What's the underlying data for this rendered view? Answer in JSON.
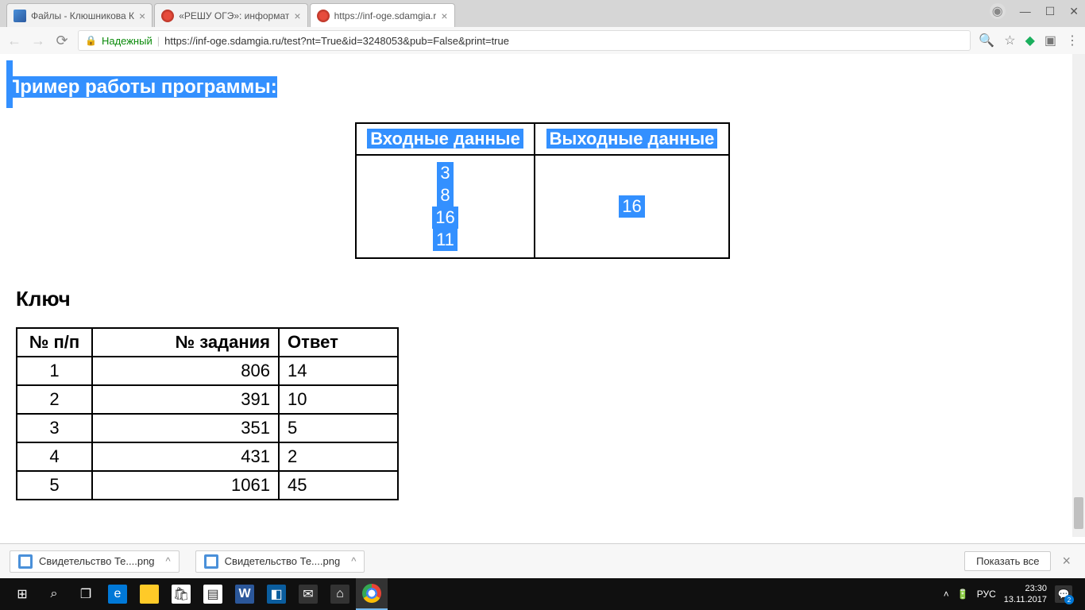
{
  "browser": {
    "tabs": [
      {
        "title": "Файлы - Клюшникова К",
        "active": false
      },
      {
        "title": "«РЕШУ ОГЭ»: информат",
        "active": false
      },
      {
        "title": "https://inf-oge.sdamgia.r",
        "active": true
      }
    ],
    "secure_label": "Надежный",
    "url": "https://inf-oge.sdamgia.ru/test?nt=True&id=3248053&pub=False&print=true"
  },
  "page": {
    "example_heading": "Пример работы программы:",
    "example_table": {
      "headers": {
        "input": "Входные данные",
        "output": "Выходные данные"
      },
      "input_data": [
        "3",
        "8",
        "16",
        "11"
      ],
      "output_data": [
        "16"
      ]
    },
    "key_heading": "Ключ",
    "answer_table": {
      "headers": {
        "num": "№ п/п",
        "task": "№ задания",
        "answer": "Ответ"
      },
      "rows": [
        {
          "num": "1",
          "task": "806",
          "answer": "14"
        },
        {
          "num": "2",
          "task": "391",
          "answer": "10"
        },
        {
          "num": "3",
          "task": "351",
          "answer": "5"
        },
        {
          "num": "4",
          "task": "431",
          "answer": "2"
        },
        {
          "num": "5",
          "task": "1061",
          "answer": "45"
        }
      ]
    }
  },
  "downloads": {
    "items": [
      {
        "name": "Свидетельство Те....png"
      },
      {
        "name": "Свидетельство Те....png"
      }
    ],
    "show_all": "Показать все"
  },
  "taskbar": {
    "lang": "РУС",
    "time": "23:30",
    "date": "13.11.2017",
    "notif_count": "2"
  }
}
